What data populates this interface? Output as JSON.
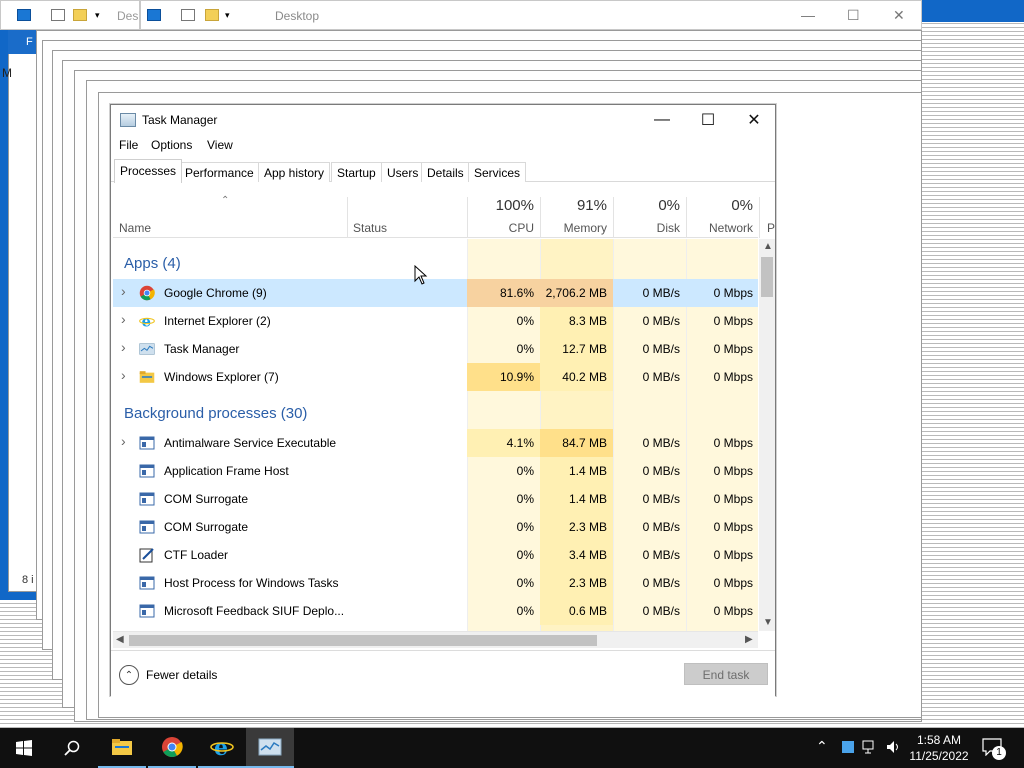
{
  "explorer": {
    "title": "Desktop",
    "title_partial": "Des",
    "side_letter": "F",
    "side_letter2": "M",
    "status_partial": "8 i"
  },
  "task_manager": {
    "title": "Task Manager",
    "menu": [
      "File",
      "Options",
      "View"
    ],
    "tabs": [
      "Processes",
      "Performance",
      "App history",
      "Startup",
      "Users",
      "Details",
      "Services"
    ],
    "active_tab": "Processes",
    "columns": {
      "name": "Name",
      "status": "Status",
      "cpu": {
        "pct": "100%",
        "label": "CPU"
      },
      "memory": {
        "pct": "91%",
        "label": "Memory"
      },
      "disk": {
        "pct": "0%",
        "label": "Disk"
      },
      "network": {
        "pct": "0%",
        "label": "Network"
      },
      "power_partial": "P"
    },
    "groups": {
      "apps": "Apps (4)",
      "background": "Background processes (30)"
    },
    "apps": [
      {
        "name": "Google Chrome (9)",
        "cpu": "81.6%",
        "memory": "2,706.2 MB",
        "disk": "0 MB/s",
        "network": "0 Mbps",
        "icon": "chrome-icon",
        "expandable": true
      },
      {
        "name": "Internet Explorer (2)",
        "cpu": "0%",
        "memory": "8.3 MB",
        "disk": "0 MB/s",
        "network": "0 Mbps",
        "icon": "ie-icon",
        "expandable": true
      },
      {
        "name": "Task Manager",
        "cpu": "0%",
        "memory": "12.7 MB",
        "disk": "0 MB/s",
        "network": "0 Mbps",
        "icon": "task-manager-icon",
        "expandable": true
      },
      {
        "name": "Windows Explorer (7)",
        "cpu": "10.9%",
        "memory": "40.2 MB",
        "disk": "0 MB/s",
        "network": "0 Mbps",
        "icon": "explorer-icon",
        "expandable": true
      }
    ],
    "background": [
      {
        "name": "Antimalware Service Executable",
        "cpu": "4.1%",
        "memory": "84.7 MB",
        "disk": "0 MB/s",
        "network": "0 Mbps",
        "expandable": true
      },
      {
        "name": "Application Frame Host",
        "cpu": "0%",
        "memory": "1.4 MB",
        "disk": "0 MB/s",
        "network": "0 Mbps",
        "expandable": false
      },
      {
        "name": "COM Surrogate",
        "cpu": "0%",
        "memory": "1.4 MB",
        "disk": "0 MB/s",
        "network": "0 Mbps",
        "expandable": false
      },
      {
        "name": "COM Surrogate",
        "cpu": "0%",
        "memory": "2.3 MB",
        "disk": "0 MB/s",
        "network": "0 Mbps",
        "expandable": false
      },
      {
        "name": "CTF Loader",
        "cpu": "0%",
        "memory": "3.4 MB",
        "disk": "0 MB/s",
        "network": "0 Mbps",
        "expandable": false
      },
      {
        "name": "Host Process for Windows Tasks",
        "cpu": "0%",
        "memory": "2.3 MB",
        "disk": "0 MB/s",
        "network": "0 Mbps",
        "expandable": false
      },
      {
        "name": "Microsoft Feedback SIUF Deplo...",
        "cpu": "0%",
        "memory": "0.6 MB",
        "disk": "0 MB/s",
        "network": "0 Mbps",
        "expandable": false
      }
    ],
    "fewer_details": "Fewer details",
    "end_task": "End task"
  },
  "taskbar": {
    "time": "1:58 AM",
    "date": "11/25/2022",
    "notification_count": "1"
  },
  "colors": {
    "accent": "#1167c7",
    "selected_row": "#cce8ff",
    "heat_light": "#fff8dc",
    "heat_mid": "#fff0b3",
    "heat_strong": "#ffe08a",
    "heat_cpu_high": "#f7d2a0",
    "group_text": "#2a5ea8",
    "taskbar": "#101010"
  }
}
